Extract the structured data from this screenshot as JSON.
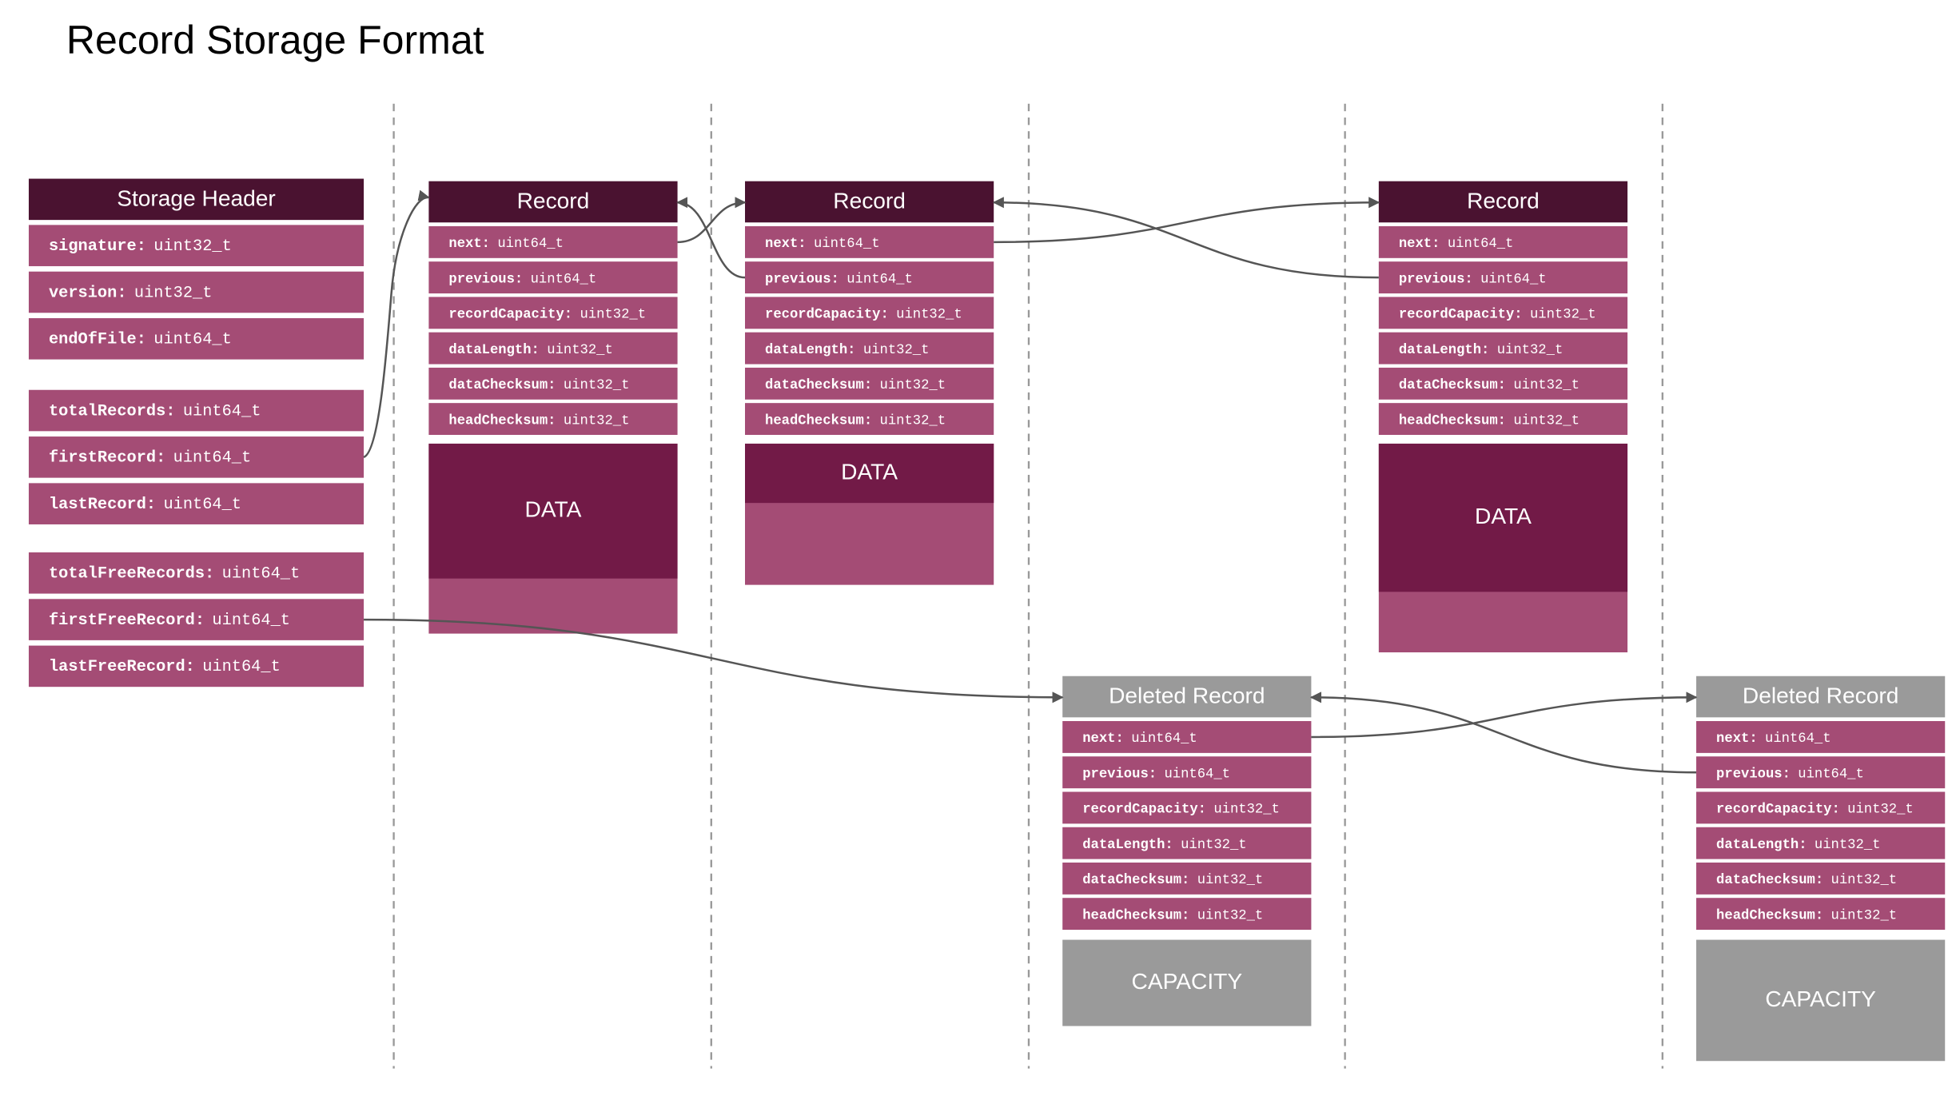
{
  "title": "Record Storage Format",
  "colors": {
    "header_bg": "#4a1230",
    "field_bg": "#a44c75",
    "data_bg": "#721a47",
    "deleted_bg": "#9a9a9a",
    "arrow": "#555555",
    "divider": "#999999"
  },
  "storage_header": {
    "title": "Storage Header",
    "groups": [
      [
        {
          "name": "signature",
          "type": "uint32_t"
        },
        {
          "name": "version",
          "type": "uint32_t"
        },
        {
          "name": "endOfFile",
          "type": "uint64_t"
        }
      ],
      [
        {
          "name": "totalRecords",
          "type": "uint64_t"
        },
        {
          "name": "firstRecord",
          "type": "uint64_t"
        },
        {
          "name": "lastRecord",
          "type": "uint64_t"
        }
      ],
      [
        {
          "name": "totalFreeRecords",
          "type": "uint64_t"
        },
        {
          "name": "firstFreeRecord",
          "type": "uint64_t"
        },
        {
          "name": "lastFreeRecord",
          "type": "uint64_t"
        }
      ]
    ]
  },
  "record_fields": [
    {
      "name": "next",
      "type": "uint64_t"
    },
    {
      "name": "previous",
      "type": "uint64_t"
    },
    {
      "name": "recordCapacity",
      "type": "uint32_t"
    },
    {
      "name": "dataLength",
      "type": "uint32_t"
    },
    {
      "name": "dataChecksum",
      "type": "uint32_t"
    },
    {
      "name": "headChecksum",
      "type": "uint32_t"
    }
  ],
  "records": [
    {
      "title": "Record",
      "kind": "active",
      "body_label": "DATA",
      "data_fill_fraction": 0.71
    },
    {
      "title": "Record",
      "kind": "active",
      "body_label": "DATA",
      "data_fill_fraction": 0.42
    },
    {
      "title": "Record",
      "kind": "active",
      "body_label": "DATA",
      "data_fill_fraction": 0.71
    },
    {
      "title": "Deleted Record",
      "kind": "deleted",
      "body_label": "CAPACITY",
      "data_fill_fraction": 1.0
    },
    {
      "title": "Deleted Record",
      "kind": "deleted",
      "body_label": "CAPACITY",
      "data_fill_fraction": 1.0
    }
  ],
  "links": [
    {
      "from": "storage_header.firstRecord",
      "to": "record_1"
    },
    {
      "from": "record_1.next",
      "to": "record_2"
    },
    {
      "from": "record_2.previous",
      "to": "record_1"
    },
    {
      "from": "record_2.next",
      "to": "record_3"
    },
    {
      "from": "record_3.previous",
      "to": "record_2"
    },
    {
      "from": "storage_header.firstFreeRecord",
      "to": "deleted_record_1"
    },
    {
      "from": "deleted_record_1.next",
      "to": "deleted_record_2"
    },
    {
      "from": "deleted_record_2.previous",
      "to": "deleted_record_1"
    }
  ]
}
